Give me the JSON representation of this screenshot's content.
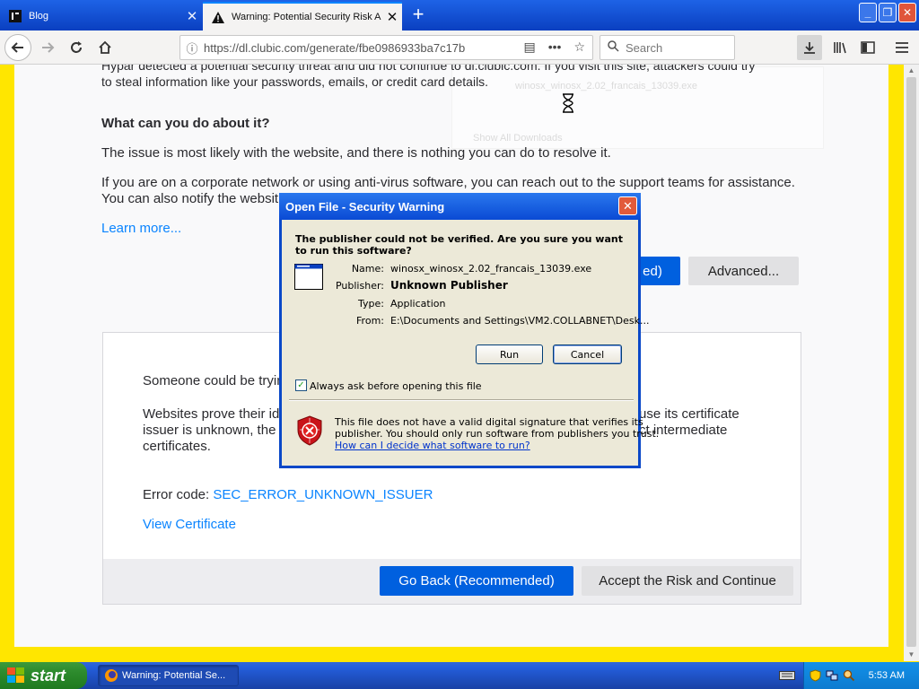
{
  "browser": {
    "tabs": [
      {
        "title": "Blog",
        "active": false
      },
      {
        "title": "Warning: Potential Security Risk A",
        "active": true
      }
    ],
    "url": "https://dl.clubic.com/generate/fbe0986933ba7c17b",
    "search_placeholder": "Search"
  },
  "page": {
    "intro_line1": "Hypar detected a potential security threat and did not continue to dl.clubic.com. If you visit this site, attackers could try",
    "intro_line2": "to steal information like your passwords, emails, or credit card details.",
    "what_heading": "What can you do about it?",
    "issue_text": "The issue is most likely with the website, and there is nothing you can do to resolve it.",
    "corp_line1": "If you are on a corporate network or using anti-virus software, you can reach out to the support teams for assistance.",
    "corp_line2": "You can also notify the websit",
    "learn_more": "Learn more...",
    "partial_button": "ed)",
    "advanced_button": "Advanced...",
    "someone_text": "Someone could be tryin",
    "websites_prove": "Websites prove their ide",
    "cert_right1": "use its certificate",
    "issuer_text": "issuer is unknown, the c",
    "cert_right2": "ct intermediate",
    "certificates": "certificates.",
    "error_label": "Error code: ",
    "error_code": "SEC_ERROR_UNKNOWN_ISSUER",
    "view_certificate": "View Certificate",
    "go_back": "Go Back (Recommended)",
    "accept_risk": "Accept the Risk and Continue",
    "ghost_file": "winosx_winosx_2.02_francais_13039.exe",
    "ghost_show": "Show All Downloads"
  },
  "dialog": {
    "title": "Open File - Security Warning",
    "question": "The publisher could not be verified.  Are you sure you want to run this software?",
    "name_label": "Name:",
    "name_value": "winosx_winosx_2.02_francais_13039.exe",
    "publisher_label": "Publisher:",
    "publisher_value": "Unknown Publisher",
    "type_label": "Type:",
    "type_value": "Application",
    "from_label": "From:",
    "from_value": "E:\\Documents and Settings\\VM2.COLLABNET\\Desk...",
    "run_button": "Run",
    "cancel_button": "Cancel",
    "always_ask": "Always ask before opening this file",
    "always_ask_checked": true,
    "warning_line1": "This file does not have a valid digital signature that verifies its",
    "warning_line2": "publisher.  You should only run software from publishers you trust.",
    "help_link": "How can I decide what software to run?"
  },
  "taskbar": {
    "start_label": "start",
    "task_button": "Warning: Potential Se...",
    "clock": "5:53 AM"
  },
  "colors": {
    "xp_blue": "#245edb",
    "firefox_blue": "#0060df",
    "link_blue": "#0a84ff",
    "frame_yellow": "#ffe600"
  }
}
